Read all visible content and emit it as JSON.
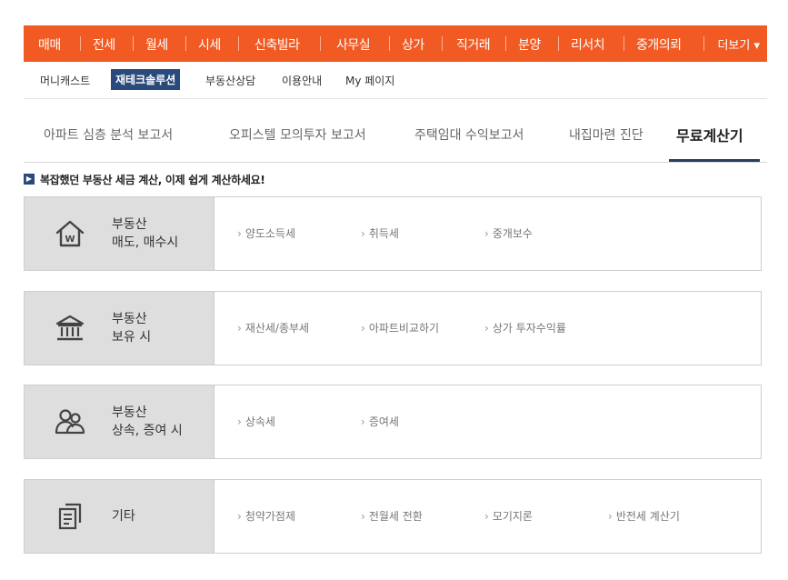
{
  "top_nav": {
    "items": [
      "매매",
      "전세",
      "월세",
      "시세",
      "신축빌라",
      "사무실",
      "상가",
      "직거래",
      "분양",
      "리서치",
      "중개의뢰"
    ],
    "more": "더보기 ▾"
  },
  "sub_nav": {
    "items": [
      "머니캐스트",
      "재테크솔루션",
      "부동산상담",
      "이용안내",
      "My 페이지"
    ],
    "active_index": 1
  },
  "tabs": {
    "items": [
      "아파트 심층 분석 보고서",
      "오피스텔 모의투자 보고서",
      "주택임대 수익보고서",
      "내집마련 진단",
      "무료계산기"
    ],
    "active_index": 4
  },
  "notice": "복잡했던 부동산 세금 계산, 이제 쉽게 계산하세요!",
  "categories": [
    {
      "icon": "house-w-icon",
      "line1": "부동산",
      "line2": "매도, 매수시",
      "links": [
        "양도소득세",
        "취득세",
        "중개보수"
      ]
    },
    {
      "icon": "bank-building-icon",
      "line1": "부동산",
      "line2": "보유 시",
      "links": [
        "재산세/종부세",
        "아파트비교하기",
        "상가 투자수익률"
      ]
    },
    {
      "icon": "family-people-icon",
      "line1": "부동산",
      "line2": "상속, 증여 시",
      "links": [
        "상속세",
        "증여세"
      ]
    },
    {
      "icon": "document-copy-icon",
      "line1": "기타",
      "line2": "",
      "links": [
        "청약가점제",
        "전월세 전환",
        "모기지론",
        "반전세 계산기"
      ]
    }
  ],
  "colors": {
    "brand_orange": "#f15a22",
    "navy": "#2a4a7c"
  }
}
